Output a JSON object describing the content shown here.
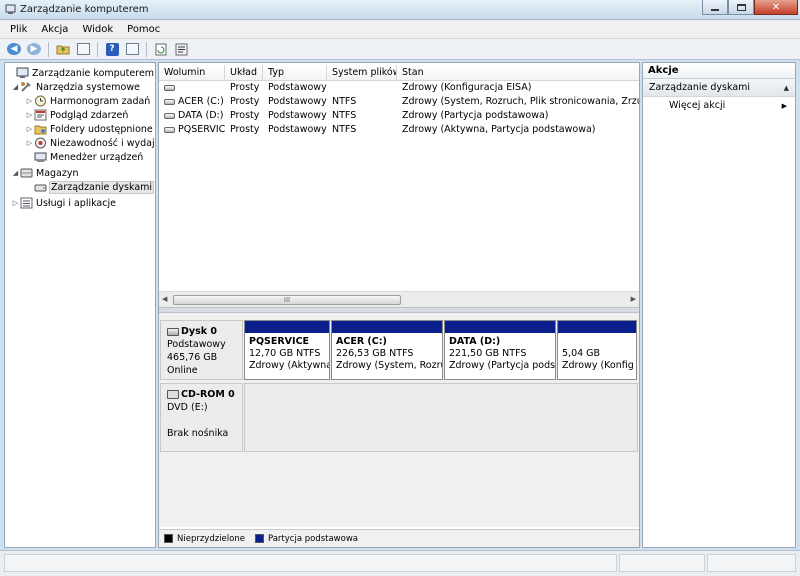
{
  "window": {
    "title": "Zarządzanie komputerem"
  },
  "menu": [
    "Plik",
    "Akcja",
    "Widok",
    "Pomoc"
  ],
  "toolbar": [
    "back-icon",
    "forward-icon",
    "up-folder-icon",
    "show-hide-tree-icon",
    "help-icon",
    "show-hide-action-icon",
    "refresh-icon",
    "properties-icon"
  ],
  "tree": {
    "root": "Zarządzanie komputerem (lokalny)",
    "system_tools": "Narzędzia systemowe",
    "task_scheduler": "Harmonogram zadań",
    "event_viewer": "Podgląd zdarzeń",
    "shared_folders": "Foldery udostępnione",
    "reliability": "Niezawodność i wydajność",
    "device_manager": "Menedżer urządzeń",
    "storage": "Magazyn",
    "disk_management": "Zarządzanie dyskami",
    "services": "Usługi i aplikacje"
  },
  "volumes": {
    "columns": [
      "Wolumin",
      "Układ",
      "Typ",
      "System plików",
      "Stan"
    ],
    "rows": [
      [
        "",
        "Prosty",
        "Podstawowy",
        "",
        "Zdrowy (Konfiguracja EISA)"
      ],
      [
        "ACER (C:)",
        "Prosty",
        "Podstawowy",
        "NTFS",
        "Zdrowy (System, Rozruch, Plik stronicowania, Zrzut awaryjny)"
      ],
      [
        "DATA (D:)",
        "Prosty",
        "Podstawowy",
        "NTFS",
        "Zdrowy (Partycja podstawowa)"
      ],
      [
        "PQSERVICE",
        "Prosty",
        "Podstawowy",
        "NTFS",
        "Zdrowy (Aktywna, Partycja podstawowa)"
      ]
    ],
    "scroll_grip": "III"
  },
  "disk0": {
    "name": "Dysk 0",
    "type": "Podstawowy",
    "size": "465,76 GB",
    "status": "Online",
    "partitions": [
      {
        "name": "PQSERVICE",
        "size": "12,70 GB NTFS",
        "status": "Zdrowy (Aktywna"
      },
      {
        "name": "ACER  (C:)",
        "size": "226,53 GB NTFS",
        "status": "Zdrowy (System, Rozruc"
      },
      {
        "name": "DATA  (D:)",
        "size": "221,50 GB NTFS",
        "status": "Zdrowy (Partycja podsta"
      },
      {
        "name": "",
        "size": "5,04 GB",
        "status": "Zdrowy (Konfig"
      }
    ]
  },
  "cdrom0": {
    "name": "CD-ROM 0",
    "drive": "DVD (E:)",
    "status": "Brak nośnika"
  },
  "legend": [
    {
      "label": "Nieprzydzielone",
      "color": "#000000"
    },
    {
      "label": "Partycja podstawowa",
      "color": "#0b1f8c"
    }
  ],
  "actions": {
    "title": "Akcje",
    "section": "Zarządzanie dyskami",
    "more": "Więcej akcji"
  },
  "colors": {
    "primary_partition": "#0b1f8c",
    "titlebar": "#c9dcec"
  }
}
